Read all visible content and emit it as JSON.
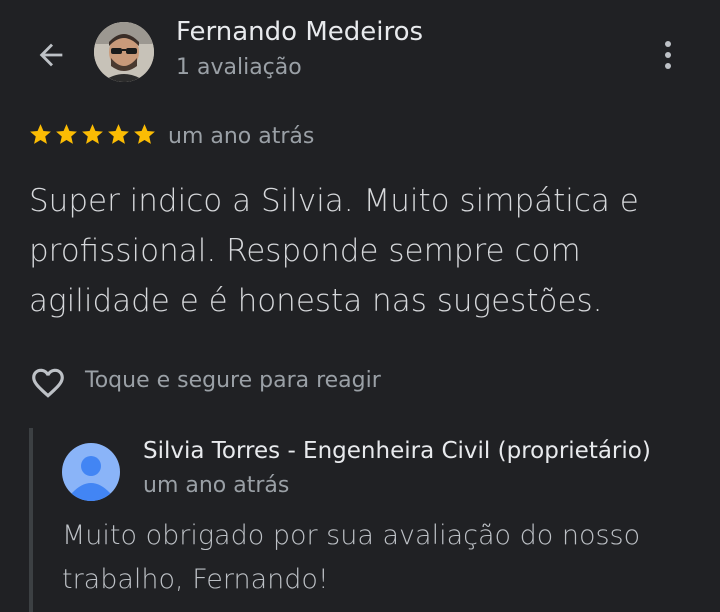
{
  "header": {
    "reviewer_name": "Fernando Medeiros",
    "review_count": "1 avaliação"
  },
  "review": {
    "rating": 5,
    "max_rating": 5,
    "time": "um ano atrás",
    "text": "Super indico a Silvia. Muito simpática e profissional. Responde sempre com agilidade e é honesta nas sugestões."
  },
  "react": {
    "label": "Toque e segure para reagir"
  },
  "owner_reply": {
    "name": "Silvia Torres - Engenheira Civil (proprietário)",
    "time": "um ano atrás",
    "text": "Muito obrigado por sua avaliação do nosso trabalho, Fernando!"
  },
  "colors": {
    "background": "#202124",
    "star": "#fbbc04",
    "secondary_text": "#9aa0a6",
    "owner_avatar": "#8ab4f8"
  },
  "icons": {
    "back": "arrow-left-icon",
    "more": "more-vert-icon",
    "star": "star-icon",
    "heart": "heart-outline-icon",
    "owner_avatar": "person-icon"
  }
}
